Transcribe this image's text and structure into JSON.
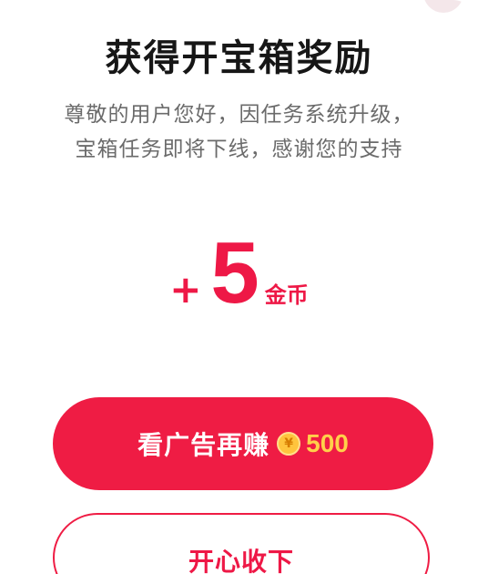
{
  "dialog": {
    "title": "获得开宝箱奖励",
    "description_line1": "尊敬的用户您好，因任务系统升级，",
    "description_line2": "宝箱任务即将下线，感谢您的支持"
  },
  "reward": {
    "prefix": "+",
    "amount": "5",
    "unit": "金币"
  },
  "primary_button": {
    "label": "看广告再赚",
    "coin_symbol": "¥",
    "coin_icon": "coin-icon",
    "bonus_amount": "500"
  },
  "secondary_button": {
    "label": "开心收下"
  },
  "colors": {
    "accent": "#ef1c44",
    "title": "#161616",
    "description": "#6b6b6b",
    "coin": "#ffc43d",
    "bonus_text": "#ffd04a"
  }
}
